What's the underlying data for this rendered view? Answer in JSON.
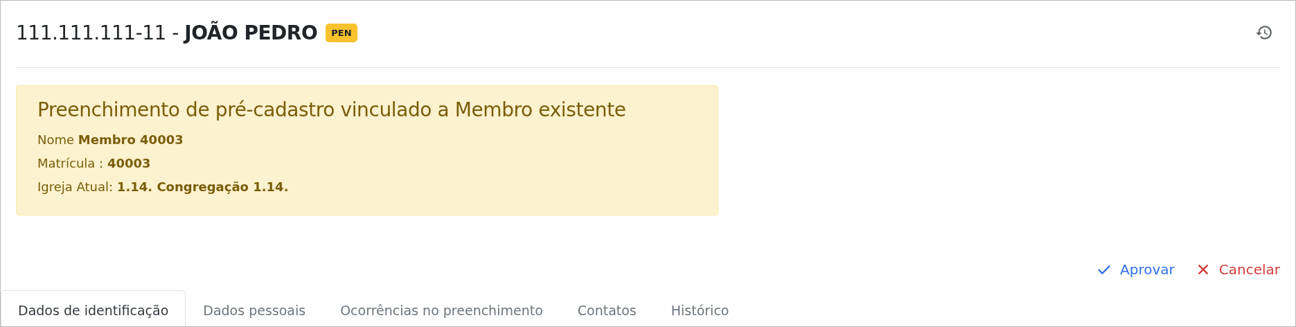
{
  "header": {
    "document": "111.111.111-11 - ",
    "name": "JOÃO PEDRO",
    "badge": "PEN"
  },
  "alert": {
    "title": "Preenchimento de pré-cadastro vinculado a Membro existente",
    "lines": [
      "Nome **Membro 40003**",
      "Matrícula : **40003**",
      "Igreja Atual: **1.14. Congregação 1.14.**"
    ]
  },
  "actions": [
    {
      "kind": "approve",
      "label": "Aprovar"
    },
    {
      "kind": "cancel",
      "label": "Cancelar"
    }
  ],
  "tabs": [
    {
      "label": "Dados de identificação",
      "selected": true
    },
    {
      "label": "Dados pessoais",
      "selected": false
    },
    {
      "label": "Ocorrências no preenchimento",
      "selected": false
    },
    {
      "label": "Contatos",
      "selected": false
    },
    {
      "label": "Histórico",
      "selected": false
    }
  ]
}
